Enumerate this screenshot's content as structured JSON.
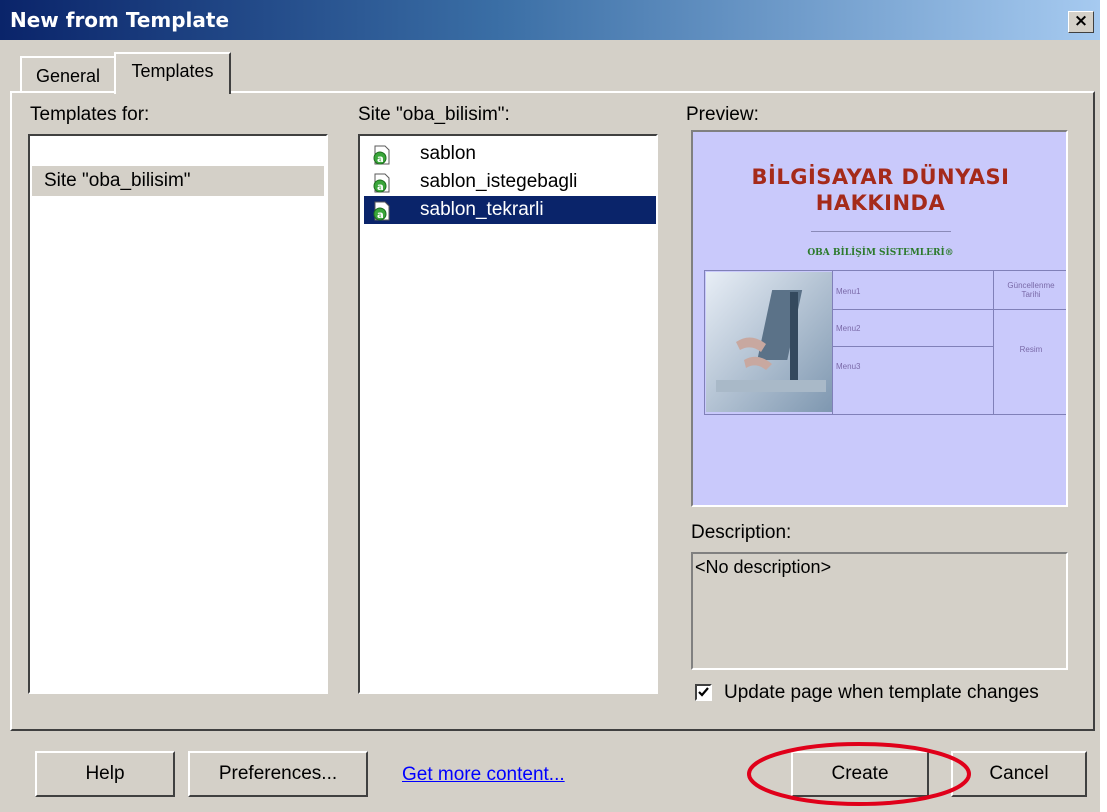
{
  "window": {
    "title": "New from Template",
    "close_glyph": "×"
  },
  "tabs": [
    {
      "label": "General",
      "active": false
    },
    {
      "label": "Templates",
      "active": true
    }
  ],
  "templates_for": {
    "label": "Templates for:",
    "items": [
      "Site \"oba_bilisim\""
    ]
  },
  "site_list": {
    "label": "Site \"oba_bilisim\":",
    "items": [
      {
        "name": "sablon",
        "icon": "template-file-icon",
        "selected": false
      },
      {
        "name": "sablon_istegebagli",
        "icon": "template-file-icon",
        "selected": false
      },
      {
        "name": "sablon_tekrarli",
        "icon": "template-file-icon",
        "selected": true
      }
    ]
  },
  "preview": {
    "label": "Preview:",
    "title_line1": "BİLGİSAYAR DÜNYASI",
    "title_line2": "HAKKINDA",
    "subtitle": "OBA BİLİŞİM SİSTEMLERİ®",
    "menu1": "Menu1",
    "menu2": "Menu2",
    "menu3": "Menu3",
    "updated": "Güncellenme Tarihi",
    "image_label": "Resim"
  },
  "description": {
    "label": "Description:",
    "text": "<No description>"
  },
  "update_checkbox": {
    "label": "Update page when template changes",
    "checked": true
  },
  "buttons": {
    "help": "Help",
    "preferences": "Preferences...",
    "get_more": "Get more content...",
    "create": "Create",
    "cancel": "Cancel"
  },
  "colors": {
    "title_bar": "#0a246a",
    "selection": "#0a246a",
    "preview_bg": "#c9c9fb",
    "annotation": "#e0001a",
    "link": "#0000ff"
  }
}
